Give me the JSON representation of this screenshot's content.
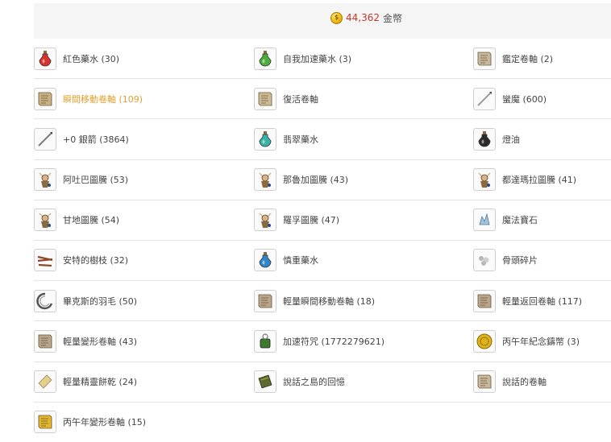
{
  "gold": {
    "amount": "44,362",
    "unit": "金幣"
  },
  "items": [
    {
      "label": "紅色藥水 (30)",
      "icon": "red-potion-icon",
      "kind": "potion",
      "color": "#d8342c"
    },
    {
      "label": "自我加速藥水 (3)",
      "icon": "green-potion-icon",
      "kind": "potion",
      "color": "#4cae3a"
    },
    {
      "label": "鑑定卷軸 (2)",
      "icon": "identify-scroll-icon",
      "kind": "scroll",
      "color": "#c7b89b"
    },
    {
      "label": "瞬間移動卷軸 (109)",
      "icon": "teleport-scroll-icon",
      "kind": "scroll",
      "color": "#c9b184",
      "highlight": true
    },
    {
      "label": "復活卷軸",
      "icon": "resurrection-scroll-icon",
      "kind": "scroll",
      "color": "#cdbb93"
    },
    {
      "label": "蠻魔 (600)",
      "icon": "arrow-icon",
      "kind": "stick",
      "color": "#9a9a9a"
    },
    {
      "label": "+0 銀箭 (3864)",
      "icon": "silver-arrow-icon",
      "kind": "stick",
      "color": "#7d7d7d"
    },
    {
      "label": "翡翠藥水",
      "icon": "emerald-potion-icon",
      "kind": "potion",
      "color": "#37b3a8"
    },
    {
      "label": "燈油",
      "icon": "lamp-oil-icon",
      "kind": "potion",
      "color": "#2a2a2a"
    },
    {
      "label": "阿吐巴圖騰 (53)",
      "icon": "atuba-totem-icon",
      "kind": "totem",
      "color": "#8a6a3e"
    },
    {
      "label": "那魯加圖騰 (43)",
      "icon": "naruga-totem-icon",
      "kind": "totem",
      "color": "#8a6a3e"
    },
    {
      "label": "都達瑪拉圖騰 (41)",
      "icon": "dudamara-totem-icon",
      "kind": "totem",
      "color": "#8a6a3e"
    },
    {
      "label": "甘地圖騰 (54)",
      "icon": "gandi-totem-icon",
      "kind": "totem",
      "color": "#8a6a3e"
    },
    {
      "label": "羅孚圖騰 (47)",
      "icon": "rova-totem-icon",
      "kind": "totem",
      "color": "#8a6a3e"
    },
    {
      "label": "魔法寶石",
      "icon": "magic-gem-icon",
      "kind": "gem",
      "color": "#9fc4e0"
    },
    {
      "label": "安特的樹枝 (32)",
      "icon": "ent-branch-icon",
      "kind": "branch",
      "color": "#8b4a2a"
    },
    {
      "label": "慎重藥水",
      "icon": "caution-potion-icon",
      "kind": "potion",
      "color": "#2f86c9"
    },
    {
      "label": "骨頭碎片",
      "icon": "bone-shard-icon",
      "kind": "bone",
      "color": "#b8b8b8"
    },
    {
      "label": "畢克斯的羽毛 (50)",
      "icon": "feather-icon",
      "kind": "feather",
      "color": "#555555"
    },
    {
      "label": "輕量瞬間移動卷軸 (18)",
      "icon": "light-teleport-scroll-icon",
      "kind": "scroll",
      "color": "#b9a58a"
    },
    {
      "label": "輕量返回卷軸 (117)",
      "icon": "light-return-scroll-icon",
      "kind": "scroll",
      "color": "#b9a58a"
    },
    {
      "label": "輕量變形卷軸 (43)",
      "icon": "light-polymorph-scroll-icon",
      "kind": "scroll",
      "color": "#b9a58a"
    },
    {
      "label": "加速符咒 (1772279621)",
      "icon": "haste-charm-icon",
      "kind": "charm",
      "color": "#3d7a2e"
    },
    {
      "label": "丙午年紀念鑄幣 (3)",
      "icon": "commemorative-coin-icon",
      "kind": "coin",
      "color": "#e0b21e"
    },
    {
      "label": "輕量精靈餅乾 (24)",
      "icon": "elven-wafer-icon",
      "kind": "wafer",
      "color": "#e2cf8f"
    },
    {
      "label": "說話之島的回憶",
      "icon": "island-memory-book-icon",
      "kind": "book",
      "color": "#5d6b2e"
    },
    {
      "label": "說話的卷軸",
      "icon": "talking-scroll-icon",
      "kind": "scroll",
      "color": "#c9b89a"
    },
    {
      "label": "丙午年變形卷軸 (15)",
      "icon": "year-polymorph-scroll-icon",
      "kind": "scroll",
      "color": "#e3b52a"
    }
  ]
}
